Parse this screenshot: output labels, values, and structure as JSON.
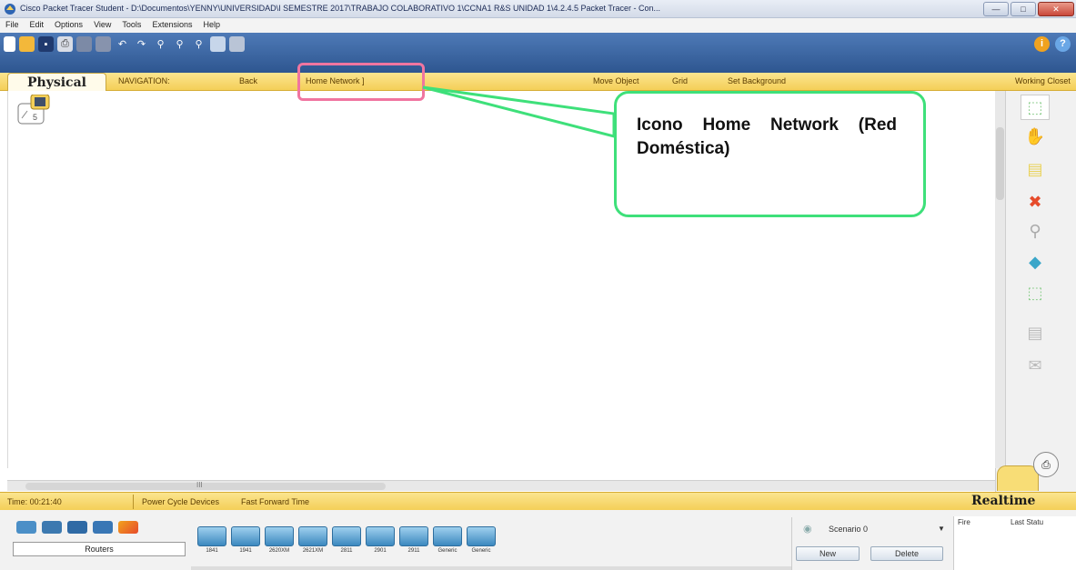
{
  "window": {
    "title": "Cisco Packet Tracer Student - D:\\Documentos\\YENNY\\UNIVERSIDAD\\I SEMESTRE 2017\\TRABAJO COLABORATIVO 1\\CCNA1 R&S UNIDAD 1\\4.2.4.5 Packet Tracer - Con...",
    "icon": "packet-tracer-logo"
  },
  "menu": [
    "File",
    "Edit",
    "Options",
    "View",
    "Tools",
    "Extensions",
    "Help"
  ],
  "navigation": {
    "physical_tab": "Physical",
    "nav_label": "NAVIGATION:",
    "back": "Back",
    "location": "Home Network ]",
    "move_object": "Move Object",
    "grid": "Grid",
    "set_background": "Set Background",
    "working_closet": "Working Closet"
  },
  "status": {
    "time": "Time: 00:21:40",
    "power_cycle": "Power Cycle Devices",
    "fast_forward": "Fast Forward Time",
    "mode": "Realtime"
  },
  "devices": {
    "category": "Routers",
    "models": [
      "1841",
      "1941",
      "2620XM",
      "2621XM",
      "2811",
      "2901",
      "2911",
      "Generic",
      "Generic"
    ]
  },
  "scenario": {
    "selected": "Scenario 0",
    "new": "New",
    "delete": "Delete"
  },
  "events": {
    "fire": "Fire",
    "last_status": "Last Statu"
  },
  "callout": {
    "text": "Icono Home Network (Red Doméstica)"
  },
  "colors": {
    "toolbar": "#2e5690",
    "navbar": "#f4cf58",
    "highlight": "#f075a0",
    "callout_border": "#3ee07a"
  }
}
